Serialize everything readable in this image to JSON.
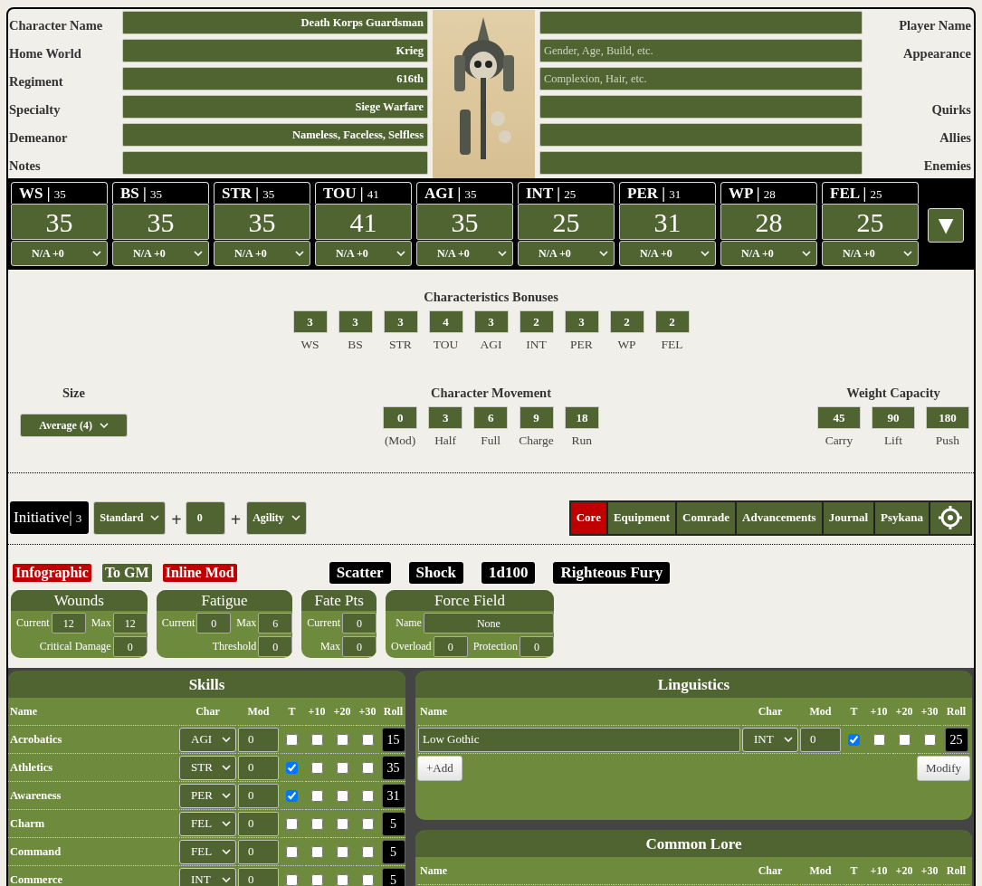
{
  "identity": {
    "left_fields": [
      {
        "label": "Character Name",
        "value": "Death Korps Guardsman"
      },
      {
        "label": "Home World",
        "value": "Krieg"
      },
      {
        "label": "Regiment",
        "value": "616th"
      },
      {
        "label": "Specialty",
        "value": "Siege Warfare"
      },
      {
        "label": "Demeanor",
        "value": "Nameless, Faceless, Selfless"
      },
      {
        "label": "Notes"
      }
    ],
    "right_fields": [
      {
        "label": "Player Name"
      },
      {
        "label": "Appearance",
        "placeholder": "Gender, Age, Build, etc."
      },
      {
        "placeholder": "Complexion, Hair, etc."
      },
      {
        "label": "Quirks"
      },
      {
        "label": "Allies"
      },
      {
        "label": "Enemies"
      }
    ]
  },
  "characteristics": {
    "separator": "|",
    "items": [
      {
        "abbr": "WS",
        "header_value": "35",
        "value": "35",
        "modifier": "N/A +0"
      },
      {
        "abbr": "BS",
        "header_value": "35",
        "value": "35",
        "modifier": "N/A +0"
      },
      {
        "abbr": "STR",
        "header_value": "35",
        "value": "35",
        "modifier": "N/A +0"
      },
      {
        "abbr": "TOU",
        "header_value": "41",
        "value": "41",
        "modifier": "N/A +0"
      },
      {
        "abbr": "AGI",
        "header_value": "35",
        "value": "35",
        "modifier": "N/A +0"
      },
      {
        "abbr": "INT",
        "header_value": "25",
        "value": "25",
        "modifier": "N/A +0"
      },
      {
        "abbr": "PER",
        "header_value": "31",
        "value": "31",
        "modifier": "N/A +0"
      },
      {
        "abbr": "WP",
        "header_value": "28",
        "value": "28",
        "modifier": "N/A +0"
      },
      {
        "abbr": "FEL",
        "header_value": "25",
        "value": "25",
        "modifier": "N/A +0"
      }
    ],
    "expand_button": "▼"
  },
  "bonuses": {
    "title": "Characteristics Bonuses",
    "items": [
      {
        "value": "3",
        "label": "WS"
      },
      {
        "value": "3",
        "label": "BS"
      },
      {
        "value": "3",
        "label": "STR"
      },
      {
        "value": "4",
        "label": "TOU"
      },
      {
        "value": "3",
        "label": "AGI"
      },
      {
        "value": "2",
        "label": "INT"
      },
      {
        "value": "3",
        "label": "PER"
      },
      {
        "value": "2",
        "label": "WP"
      },
      {
        "value": "2",
        "label": "FEL"
      }
    ]
  },
  "size": {
    "title": "Size",
    "value": "Average (4)"
  },
  "movement": {
    "title": "Character Movement",
    "items": [
      {
        "value": "0",
        "label": "(Mod)"
      },
      {
        "value": "3",
        "label": "Half"
      },
      {
        "value": "6",
        "label": "Full"
      },
      {
        "value": "9",
        "label": "Charge"
      },
      {
        "value": "18",
        "label": "Run"
      }
    ]
  },
  "weight": {
    "title": "Weight Capacity",
    "items": [
      {
        "value": "45",
        "label": "Carry"
      },
      {
        "value": "90",
        "label": "Lift"
      },
      {
        "value": "180",
        "label": "Push"
      }
    ]
  },
  "initiative": {
    "label": "Initiative|",
    "value": "3",
    "roll_type": "Standard",
    "plus_1": "+",
    "mod": "0",
    "plus_2": "+",
    "characteristic": "Agility"
  },
  "tabs": [
    {
      "label": "Core",
      "selected": true
    },
    {
      "label": "Equipment",
      "selected": false
    },
    {
      "label": "Comrade",
      "selected": false
    },
    {
      "label": "Advancements",
      "selected": false
    },
    {
      "label": "Journal",
      "selected": false
    },
    {
      "label": "Psykana",
      "selected": false
    }
  ],
  "toggles": [
    {
      "label": "Infographic",
      "on": true
    },
    {
      "label": "To GM",
      "on": false
    },
    {
      "label": "Inline Mod",
      "on": true
    }
  ],
  "roll_buttons": [
    "Scatter",
    "Shock",
    "1d100",
    "Righteous Fury"
  ],
  "cards": [
    {
      "title": "Wounds",
      "upper_fields": [
        {
          "label": "Current",
          "value": "12"
        },
        {
          "label": "Max",
          "value": "12"
        }
      ],
      "lower_fields": [
        {
          "label": "Critical Damage",
          "value": "0"
        }
      ]
    },
    {
      "title": "Fatigue",
      "upper_fields": [
        {
          "label": "Current",
          "value": "0"
        },
        {
          "label": "Max",
          "value": "6"
        }
      ],
      "lower_fields": [
        {
          "label": "Threshold",
          "value": "0"
        }
      ]
    },
    {
      "title": "Fate Pts",
      "upper_fields": [
        {
          "label": "Current",
          "value": "0"
        }
      ],
      "lower_fields": [
        {
          "label": "Max",
          "value": "0"
        }
      ]
    },
    {
      "title": "Force Field",
      "upper_fields": [
        {
          "label": "Name",
          "value": "None"
        }
      ],
      "lower_fields": [
        {
          "label": "Overload",
          "value": "0"
        },
        {
          "label": "Protection",
          "value": "0"
        }
      ]
    }
  ],
  "skills": {
    "title": "Skills",
    "columns": [
      "Name",
      "Char",
      "Mod",
      "T",
      "+10",
      "+20",
      "+30",
      "Roll"
    ],
    "rows": [
      {
        "name": "Acrobatics",
        "char": "AGI",
        "mod": "0",
        "trained": false,
        "plus_10": false,
        "plus_20": false,
        "plus_30": false,
        "roll": "15"
      },
      {
        "name": "Athletics",
        "char": "STR",
        "mod": "0",
        "trained": true,
        "plus_10": false,
        "plus_20": false,
        "plus_30": false,
        "roll": "35"
      },
      {
        "name": "Awareness",
        "char": "PER",
        "mod": "0",
        "trained": true,
        "plus_10": false,
        "plus_20": false,
        "plus_30": false,
        "roll": "31"
      },
      {
        "name": "Charm",
        "char": "FEL",
        "mod": "0",
        "trained": false,
        "plus_10": false,
        "plus_20": false,
        "plus_30": false,
        "roll": "5"
      },
      {
        "name": "Command",
        "char": "FEL",
        "mod": "0",
        "trained": false,
        "plus_10": false,
        "plus_20": false,
        "plus_30": false,
        "roll": "5"
      },
      {
        "name": "Commerce",
        "char": "INT",
        "mod": "0",
        "trained": false,
        "plus_10": false,
        "plus_20": false,
        "plus_30": false,
        "roll": "5"
      }
    ]
  },
  "linguistics": {
    "title": "Linguistics",
    "columns": [
      "Name",
      "Char",
      "Mod",
      "T",
      "+10",
      "+20",
      "+30",
      "Roll"
    ],
    "rows": [
      {
        "name": "Low Gothic",
        "char": "INT",
        "mod": "0",
        "trained": true,
        "plus_10": false,
        "plus_20": false,
        "plus_30": false,
        "roll": "25"
      }
    ],
    "add_button": "+Add",
    "modify_button": "Modify"
  },
  "common_lore": {
    "title": "Common Lore",
    "columns": [
      "Name",
      "Char",
      "Mod",
      "T",
      "+10",
      "+20",
      "+30",
      "Roll"
    ]
  }
}
